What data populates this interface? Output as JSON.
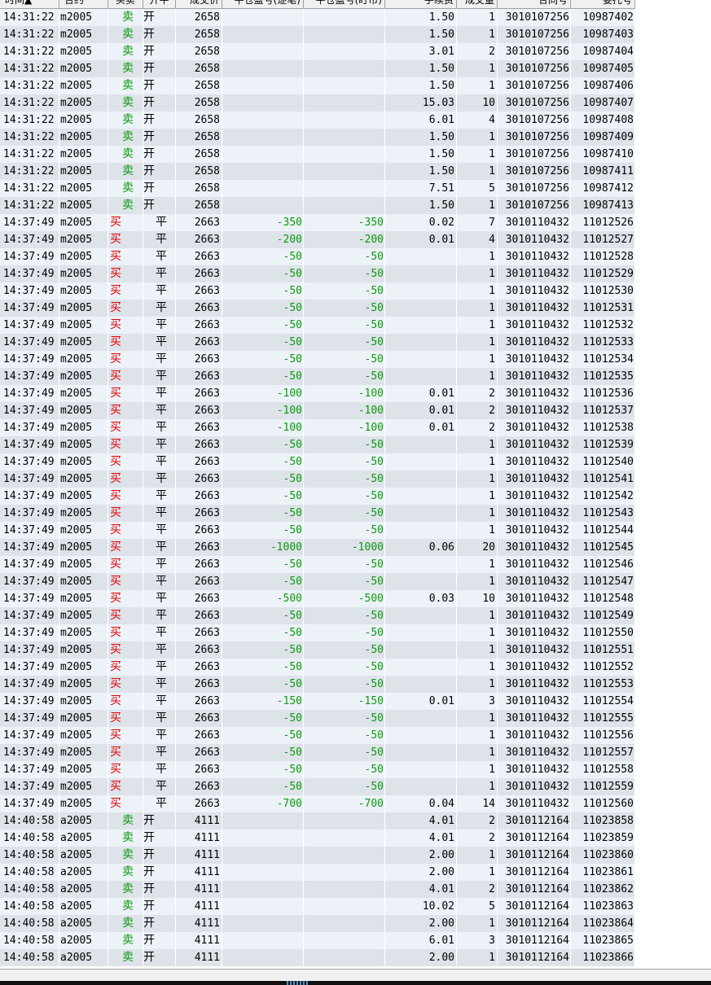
{
  "columns": [
    {
      "key": "time",
      "label": "时间▲"
    },
    {
      "key": "contract",
      "label": "合约"
    },
    {
      "key": "side",
      "label": "买卖"
    },
    {
      "key": "oc",
      "label": "开平"
    },
    {
      "key": "price",
      "label": "成交价"
    },
    {
      "key": "pnl_each",
      "label": "平仓盈亏(逐笔)"
    },
    {
      "key": "pnl_mark",
      "label": "平仓盈亏(盯市)"
    },
    {
      "key": "fee",
      "label": "手续费"
    },
    {
      "key": "qty",
      "label": "成交量"
    },
    {
      "key": "trade_no",
      "label": "合同号"
    },
    {
      "key": "order_no",
      "label": "委托号"
    }
  ],
  "colors": {
    "buy": "#e00000",
    "sell": "#0a9a0a",
    "pnl": "#0a9a0a",
    "row_odd": "#edf2f9",
    "row_even": "#dee3ea"
  },
  "rows": [
    {
      "time": "14:31:22",
      "contract": "m2005",
      "side": "卖",
      "oc": "开",
      "price": "2658",
      "pnl_each": "",
      "pnl_mark": "",
      "fee": "1.50",
      "qty": "1",
      "trade_no": "3010107256",
      "order_no": "10987402"
    },
    {
      "time": "14:31:22",
      "contract": "m2005",
      "side": "卖",
      "oc": "开",
      "price": "2658",
      "pnl_each": "",
      "pnl_mark": "",
      "fee": "1.50",
      "qty": "1",
      "trade_no": "3010107256",
      "order_no": "10987403"
    },
    {
      "time": "14:31:22",
      "contract": "m2005",
      "side": "卖",
      "oc": "开",
      "price": "2658",
      "pnl_each": "",
      "pnl_mark": "",
      "fee": "3.01",
      "qty": "2",
      "trade_no": "3010107256",
      "order_no": "10987404"
    },
    {
      "time": "14:31:22",
      "contract": "m2005",
      "side": "卖",
      "oc": "开",
      "price": "2658",
      "pnl_each": "",
      "pnl_mark": "",
      "fee": "1.50",
      "qty": "1",
      "trade_no": "3010107256",
      "order_no": "10987405"
    },
    {
      "time": "14:31:22",
      "contract": "m2005",
      "side": "卖",
      "oc": "开",
      "price": "2658",
      "pnl_each": "",
      "pnl_mark": "",
      "fee": "1.50",
      "qty": "1",
      "trade_no": "3010107256",
      "order_no": "10987406"
    },
    {
      "time": "14:31:22",
      "contract": "m2005",
      "side": "卖",
      "oc": "开",
      "price": "2658",
      "pnl_each": "",
      "pnl_mark": "",
      "fee": "15.03",
      "qty": "10",
      "trade_no": "3010107256",
      "order_no": "10987407"
    },
    {
      "time": "14:31:22",
      "contract": "m2005",
      "side": "卖",
      "oc": "开",
      "price": "2658",
      "pnl_each": "",
      "pnl_mark": "",
      "fee": "6.01",
      "qty": "4",
      "trade_no": "3010107256",
      "order_no": "10987408"
    },
    {
      "time": "14:31:22",
      "contract": "m2005",
      "side": "卖",
      "oc": "开",
      "price": "2658",
      "pnl_each": "",
      "pnl_mark": "",
      "fee": "1.50",
      "qty": "1",
      "trade_no": "3010107256",
      "order_no": "10987409"
    },
    {
      "time": "14:31:22",
      "contract": "m2005",
      "side": "卖",
      "oc": "开",
      "price": "2658",
      "pnl_each": "",
      "pnl_mark": "",
      "fee": "1.50",
      "qty": "1",
      "trade_no": "3010107256",
      "order_no": "10987410"
    },
    {
      "time": "14:31:22",
      "contract": "m2005",
      "side": "卖",
      "oc": "开",
      "price": "2658",
      "pnl_each": "",
      "pnl_mark": "",
      "fee": "1.50",
      "qty": "1",
      "trade_no": "3010107256",
      "order_no": "10987411"
    },
    {
      "time": "14:31:22",
      "contract": "m2005",
      "side": "卖",
      "oc": "开",
      "price": "2658",
      "pnl_each": "",
      "pnl_mark": "",
      "fee": "7.51",
      "qty": "5",
      "trade_no": "3010107256",
      "order_no": "10987412"
    },
    {
      "time": "14:31:22",
      "contract": "m2005",
      "side": "卖",
      "oc": "开",
      "price": "2658",
      "pnl_each": "",
      "pnl_mark": "",
      "fee": "1.50",
      "qty": "1",
      "trade_no": "3010107256",
      "order_no": "10987413"
    },
    {
      "time": "14:37:49",
      "contract": "m2005",
      "side": "买",
      "oc": "平",
      "price": "2663",
      "pnl_each": "-350",
      "pnl_mark": "-350",
      "fee": "0.02",
      "qty": "7",
      "trade_no": "3010110432",
      "order_no": "11012526"
    },
    {
      "time": "14:37:49",
      "contract": "m2005",
      "side": "买",
      "oc": "平",
      "price": "2663",
      "pnl_each": "-200",
      "pnl_mark": "-200",
      "fee": "0.01",
      "qty": "4",
      "trade_no": "3010110432",
      "order_no": "11012527"
    },
    {
      "time": "14:37:49",
      "contract": "m2005",
      "side": "买",
      "oc": "平",
      "price": "2663",
      "pnl_each": "-50",
      "pnl_mark": "-50",
      "fee": "",
      "qty": "1",
      "trade_no": "3010110432",
      "order_no": "11012528"
    },
    {
      "time": "14:37:49",
      "contract": "m2005",
      "side": "买",
      "oc": "平",
      "price": "2663",
      "pnl_each": "-50",
      "pnl_mark": "-50",
      "fee": "",
      "qty": "1",
      "trade_no": "3010110432",
      "order_no": "11012529"
    },
    {
      "time": "14:37:49",
      "contract": "m2005",
      "side": "买",
      "oc": "平",
      "price": "2663",
      "pnl_each": "-50",
      "pnl_mark": "-50",
      "fee": "",
      "qty": "1",
      "trade_no": "3010110432",
      "order_no": "11012530"
    },
    {
      "time": "14:37:49",
      "contract": "m2005",
      "side": "买",
      "oc": "平",
      "price": "2663",
      "pnl_each": "-50",
      "pnl_mark": "-50",
      "fee": "",
      "qty": "1",
      "trade_no": "3010110432",
      "order_no": "11012531"
    },
    {
      "time": "14:37:49",
      "contract": "m2005",
      "side": "买",
      "oc": "平",
      "price": "2663",
      "pnl_each": "-50",
      "pnl_mark": "-50",
      "fee": "",
      "qty": "1",
      "trade_no": "3010110432",
      "order_no": "11012532"
    },
    {
      "time": "14:37:49",
      "contract": "m2005",
      "side": "买",
      "oc": "平",
      "price": "2663",
      "pnl_each": "-50",
      "pnl_mark": "-50",
      "fee": "",
      "qty": "1",
      "trade_no": "3010110432",
      "order_no": "11012533"
    },
    {
      "time": "14:37:49",
      "contract": "m2005",
      "side": "买",
      "oc": "平",
      "price": "2663",
      "pnl_each": "-50",
      "pnl_mark": "-50",
      "fee": "",
      "qty": "1",
      "trade_no": "3010110432",
      "order_no": "11012534"
    },
    {
      "time": "14:37:49",
      "contract": "m2005",
      "side": "买",
      "oc": "平",
      "price": "2663",
      "pnl_each": "-50",
      "pnl_mark": "-50",
      "fee": "",
      "qty": "1",
      "trade_no": "3010110432",
      "order_no": "11012535"
    },
    {
      "time": "14:37:49",
      "contract": "m2005",
      "side": "买",
      "oc": "平",
      "price": "2663",
      "pnl_each": "-100",
      "pnl_mark": "-100",
      "fee": "0.01",
      "qty": "2",
      "trade_no": "3010110432",
      "order_no": "11012536"
    },
    {
      "time": "14:37:49",
      "contract": "m2005",
      "side": "买",
      "oc": "平",
      "price": "2663",
      "pnl_each": "-100",
      "pnl_mark": "-100",
      "fee": "0.01",
      "qty": "2",
      "trade_no": "3010110432",
      "order_no": "11012537"
    },
    {
      "time": "14:37:49",
      "contract": "m2005",
      "side": "买",
      "oc": "平",
      "price": "2663",
      "pnl_each": "-100",
      "pnl_mark": "-100",
      "fee": "0.01",
      "qty": "2",
      "trade_no": "3010110432",
      "order_no": "11012538"
    },
    {
      "time": "14:37:49",
      "contract": "m2005",
      "side": "买",
      "oc": "平",
      "price": "2663",
      "pnl_each": "-50",
      "pnl_mark": "-50",
      "fee": "",
      "qty": "1",
      "trade_no": "3010110432",
      "order_no": "11012539"
    },
    {
      "time": "14:37:49",
      "contract": "m2005",
      "side": "买",
      "oc": "平",
      "price": "2663",
      "pnl_each": "-50",
      "pnl_mark": "-50",
      "fee": "",
      "qty": "1",
      "trade_no": "3010110432",
      "order_no": "11012540"
    },
    {
      "time": "14:37:49",
      "contract": "m2005",
      "side": "买",
      "oc": "平",
      "price": "2663",
      "pnl_each": "-50",
      "pnl_mark": "-50",
      "fee": "",
      "qty": "1",
      "trade_no": "3010110432",
      "order_no": "11012541"
    },
    {
      "time": "14:37:49",
      "contract": "m2005",
      "side": "买",
      "oc": "平",
      "price": "2663",
      "pnl_each": "-50",
      "pnl_mark": "-50",
      "fee": "",
      "qty": "1",
      "trade_no": "3010110432",
      "order_no": "11012542"
    },
    {
      "time": "14:37:49",
      "contract": "m2005",
      "side": "买",
      "oc": "平",
      "price": "2663",
      "pnl_each": "-50",
      "pnl_mark": "-50",
      "fee": "",
      "qty": "1",
      "trade_no": "3010110432",
      "order_no": "11012543"
    },
    {
      "time": "14:37:49",
      "contract": "m2005",
      "side": "买",
      "oc": "平",
      "price": "2663",
      "pnl_each": "-50",
      "pnl_mark": "-50",
      "fee": "",
      "qty": "1",
      "trade_no": "3010110432",
      "order_no": "11012544"
    },
    {
      "time": "14:37:49",
      "contract": "m2005",
      "side": "买",
      "oc": "平",
      "price": "2663",
      "pnl_each": "-1000",
      "pnl_mark": "-1000",
      "fee": "0.06",
      "qty": "20",
      "trade_no": "3010110432",
      "order_no": "11012545"
    },
    {
      "time": "14:37:49",
      "contract": "m2005",
      "side": "买",
      "oc": "平",
      "price": "2663",
      "pnl_each": "-50",
      "pnl_mark": "-50",
      "fee": "",
      "qty": "1",
      "trade_no": "3010110432",
      "order_no": "11012546"
    },
    {
      "time": "14:37:49",
      "contract": "m2005",
      "side": "买",
      "oc": "平",
      "price": "2663",
      "pnl_each": "-50",
      "pnl_mark": "-50",
      "fee": "",
      "qty": "1",
      "trade_no": "3010110432",
      "order_no": "11012547"
    },
    {
      "time": "14:37:49",
      "contract": "m2005",
      "side": "买",
      "oc": "平",
      "price": "2663",
      "pnl_each": "-500",
      "pnl_mark": "-500",
      "fee": "0.03",
      "qty": "10",
      "trade_no": "3010110432",
      "order_no": "11012548"
    },
    {
      "time": "14:37:49",
      "contract": "m2005",
      "side": "买",
      "oc": "平",
      "price": "2663",
      "pnl_each": "-50",
      "pnl_mark": "-50",
      "fee": "",
      "qty": "1",
      "trade_no": "3010110432",
      "order_no": "11012549"
    },
    {
      "time": "14:37:49",
      "contract": "m2005",
      "side": "买",
      "oc": "平",
      "price": "2663",
      "pnl_each": "-50",
      "pnl_mark": "-50",
      "fee": "",
      "qty": "1",
      "trade_no": "3010110432",
      "order_no": "11012550"
    },
    {
      "time": "14:37:49",
      "contract": "m2005",
      "side": "买",
      "oc": "平",
      "price": "2663",
      "pnl_each": "-50",
      "pnl_mark": "-50",
      "fee": "",
      "qty": "1",
      "trade_no": "3010110432",
      "order_no": "11012551"
    },
    {
      "time": "14:37:49",
      "contract": "m2005",
      "side": "买",
      "oc": "平",
      "price": "2663",
      "pnl_each": "-50",
      "pnl_mark": "-50",
      "fee": "",
      "qty": "1",
      "trade_no": "3010110432",
      "order_no": "11012552"
    },
    {
      "time": "14:37:49",
      "contract": "m2005",
      "side": "买",
      "oc": "平",
      "price": "2663",
      "pnl_each": "-50",
      "pnl_mark": "-50",
      "fee": "",
      "qty": "1",
      "trade_no": "3010110432",
      "order_no": "11012553"
    },
    {
      "time": "14:37:49",
      "contract": "m2005",
      "side": "买",
      "oc": "平",
      "price": "2663",
      "pnl_each": "-150",
      "pnl_mark": "-150",
      "fee": "0.01",
      "qty": "3",
      "trade_no": "3010110432",
      "order_no": "11012554"
    },
    {
      "time": "14:37:49",
      "contract": "m2005",
      "side": "买",
      "oc": "平",
      "price": "2663",
      "pnl_each": "-50",
      "pnl_mark": "-50",
      "fee": "",
      "qty": "1",
      "trade_no": "3010110432",
      "order_no": "11012555"
    },
    {
      "time": "14:37:49",
      "contract": "m2005",
      "side": "买",
      "oc": "平",
      "price": "2663",
      "pnl_each": "-50",
      "pnl_mark": "-50",
      "fee": "",
      "qty": "1",
      "trade_no": "3010110432",
      "order_no": "11012556"
    },
    {
      "time": "14:37:49",
      "contract": "m2005",
      "side": "买",
      "oc": "平",
      "price": "2663",
      "pnl_each": "-50",
      "pnl_mark": "-50",
      "fee": "",
      "qty": "1",
      "trade_no": "3010110432",
      "order_no": "11012557"
    },
    {
      "time": "14:37:49",
      "contract": "m2005",
      "side": "买",
      "oc": "平",
      "price": "2663",
      "pnl_each": "-50",
      "pnl_mark": "-50",
      "fee": "",
      "qty": "1",
      "trade_no": "3010110432",
      "order_no": "11012558"
    },
    {
      "time": "14:37:49",
      "contract": "m2005",
      "side": "买",
      "oc": "平",
      "price": "2663",
      "pnl_each": "-50",
      "pnl_mark": "-50",
      "fee": "",
      "qty": "1",
      "trade_no": "3010110432",
      "order_no": "11012559"
    },
    {
      "time": "14:37:49",
      "contract": "m2005",
      "side": "买",
      "oc": "平",
      "price": "2663",
      "pnl_each": "-700",
      "pnl_mark": "-700",
      "fee": "0.04",
      "qty": "14",
      "trade_no": "3010110432",
      "order_no": "11012560"
    },
    {
      "time": "14:40:58",
      "contract": "a2005",
      "side": "卖",
      "oc": "开",
      "price": "4111",
      "pnl_each": "",
      "pnl_mark": "",
      "fee": "4.01",
      "qty": "2",
      "trade_no": "3010112164",
      "order_no": "11023858"
    },
    {
      "time": "14:40:58",
      "contract": "a2005",
      "side": "卖",
      "oc": "开",
      "price": "4111",
      "pnl_each": "",
      "pnl_mark": "",
      "fee": "4.01",
      "qty": "2",
      "trade_no": "3010112164",
      "order_no": "11023859"
    },
    {
      "time": "14:40:58",
      "contract": "a2005",
      "side": "卖",
      "oc": "开",
      "price": "4111",
      "pnl_each": "",
      "pnl_mark": "",
      "fee": "2.00",
      "qty": "1",
      "trade_no": "3010112164",
      "order_no": "11023860"
    },
    {
      "time": "14:40:58",
      "contract": "a2005",
      "side": "卖",
      "oc": "开",
      "price": "4111",
      "pnl_each": "",
      "pnl_mark": "",
      "fee": "2.00",
      "qty": "1",
      "trade_no": "3010112164",
      "order_no": "11023861"
    },
    {
      "time": "14:40:58",
      "contract": "a2005",
      "side": "卖",
      "oc": "开",
      "price": "4111",
      "pnl_each": "",
      "pnl_mark": "",
      "fee": "4.01",
      "qty": "2",
      "trade_no": "3010112164",
      "order_no": "11023862"
    },
    {
      "time": "14:40:58",
      "contract": "a2005",
      "side": "卖",
      "oc": "开",
      "price": "4111",
      "pnl_each": "",
      "pnl_mark": "",
      "fee": "10.02",
      "qty": "5",
      "trade_no": "3010112164",
      "order_no": "11023863"
    },
    {
      "time": "14:40:58",
      "contract": "a2005",
      "side": "卖",
      "oc": "开",
      "price": "4111",
      "pnl_each": "",
      "pnl_mark": "",
      "fee": "2.00",
      "qty": "1",
      "trade_no": "3010112164",
      "order_no": "11023864"
    },
    {
      "time": "14:40:58",
      "contract": "a2005",
      "side": "卖",
      "oc": "开",
      "price": "4111",
      "pnl_each": "",
      "pnl_mark": "",
      "fee": "6.01",
      "qty": "3",
      "trade_no": "3010112164",
      "order_no": "11023865"
    },
    {
      "time": "14:40:58",
      "contract": "a2005",
      "side": "卖",
      "oc": "开",
      "price": "4111",
      "pnl_each": "",
      "pnl_mark": "",
      "fee": "2.00",
      "qty": "1",
      "trade_no": "3010112164",
      "order_no": "11023866"
    }
  ]
}
